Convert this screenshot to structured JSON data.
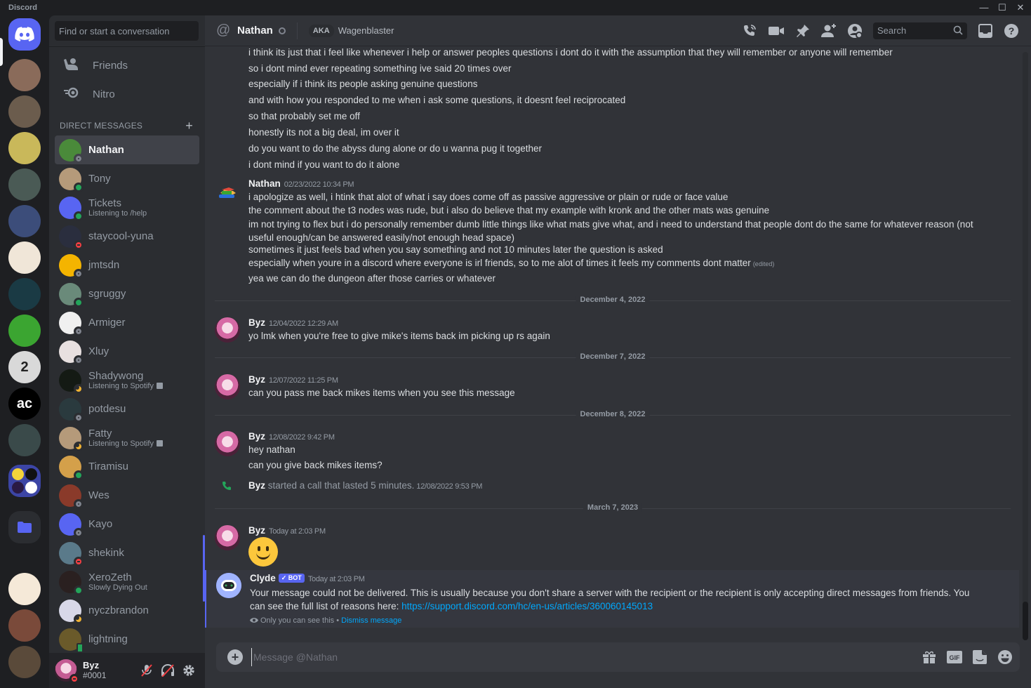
{
  "window": {
    "app_title": "Discord",
    "controls": [
      "minimize",
      "maximize",
      "close"
    ]
  },
  "server_rail": {
    "home_icon": "discord-logo-icon",
    "servers": [
      {
        "name": "server-1",
        "color": "#8a6b5a"
      },
      {
        "name": "server-2",
        "color": "#6b5c4d"
      },
      {
        "name": "server-3",
        "color": "#c9b85a"
      },
      {
        "name": "server-4",
        "color": "#4a5a55"
      },
      {
        "name": "server-5",
        "color": "#3c4d7a"
      },
      {
        "name": "server-6",
        "color": "#f0e6d8"
      },
      {
        "name": "server-7",
        "color": "#1a3a44"
      },
      {
        "name": "server-8",
        "color": "#3ba531"
      },
      {
        "name": "server-9",
        "color": "#d9d9d9",
        "label": "2"
      },
      {
        "name": "server-10",
        "color": "#000000",
        "label": "ac"
      },
      {
        "name": "server-11",
        "color": "#3a4a4a"
      },
      {
        "name": "server-12",
        "color": "#b57070"
      },
      {
        "name": "server-13",
        "color": "#f5e9d8"
      },
      {
        "name": "server-14",
        "color": "#7a4a3a"
      },
      {
        "name": "server-15",
        "color": "#5a4a3a"
      }
    ],
    "folder_icon": "folder-icon"
  },
  "sidebar": {
    "search_placeholder": "Find or start a conversation",
    "nav": [
      {
        "label": "Friends",
        "icon": "friends-icon"
      },
      {
        "label": "Nitro",
        "icon": "nitro-icon"
      }
    ],
    "dm_header": "DIRECT MESSAGES",
    "dms": [
      {
        "name": "Nathan",
        "status": "offline",
        "active": true,
        "color": "#4a8a3a"
      },
      {
        "name": "Tony",
        "status": "online",
        "color": "#b59a7a"
      },
      {
        "name": "Tickets",
        "sub": "Listening to /help",
        "status": "online",
        "color": "#5865f2"
      },
      {
        "name": "staycool-yuna",
        "status": "dnd",
        "color": "#2a2e3e"
      },
      {
        "name": "jmtsdn",
        "status": "offline",
        "color": "#f4b400"
      },
      {
        "name": "sgruggy",
        "status": "online",
        "color": "#6a8a7a"
      },
      {
        "name": "Armiger",
        "status": "offline",
        "color": "#f0f0f0"
      },
      {
        "name": "Xluy",
        "status": "offline",
        "color": "#e8e0e0"
      },
      {
        "name": "Shadywong",
        "sub": "Listening to Spotify",
        "rich": true,
        "status": "idle",
        "color": "#141a14"
      },
      {
        "name": "potdesu",
        "status": "offline",
        "color": "#2a3a3e"
      },
      {
        "name": "Fatty",
        "sub": "Listening to Spotify",
        "rich": true,
        "status": "idle",
        "color": "#b59a7a"
      },
      {
        "name": "Tiramisu",
        "status": "online",
        "color": "#d4a04a"
      },
      {
        "name": "Wes",
        "status": "offline",
        "color": "#8a3a2a"
      },
      {
        "name": "Kayo",
        "status": "offline",
        "color": "#5865f2"
      },
      {
        "name": "shekink",
        "status": "dnd",
        "color": "#5a7a8a"
      },
      {
        "name": "XeroZeth",
        "sub": "Slowly Dying Out",
        "status": "online",
        "color": "#2a2020"
      },
      {
        "name": "nyczbrandon",
        "status": "idle",
        "color": "#d8d8e8"
      },
      {
        "name": "lightning",
        "status": "mobile",
        "color": "#6a5a2a"
      }
    ],
    "user": {
      "name": "Byz",
      "tag": "#0001",
      "status": "dnd",
      "controls": [
        "mic-muted-icon",
        "headphones-deafened-icon",
        "settings-gear-icon"
      ]
    }
  },
  "header": {
    "channel_name": "Nathan",
    "aka_label": "AKA",
    "aka_value": "Wagenblaster",
    "search_placeholder": "Search",
    "icons": [
      "voice-call-icon",
      "video-call-icon",
      "pinned-messages-icon",
      "add-friends-icon",
      "user-profile-icon",
      "inbox-icon",
      "help-icon"
    ]
  },
  "messages": {
    "group1_lines": [
      "i think its just that i feel like whenever i help or answer peoples questions i dont do it with the assumption that they will remember or anyone will remember",
      "so i dont mind ever repeating something ive said 20 times over",
      "especially if i think its people asking genuine questions",
      "and with how you responded to me when i ask some questions, it doesnt feel reciprocated",
      "so that probably set me off",
      "honestly its not a big deal, im over it",
      "do you want to do the abyss dung alone or do u wanna pug it together",
      "i dont mind if you want to do it alone"
    ],
    "group2": {
      "author": "Nathan",
      "timestamp": "02/23/2022 10:34 PM",
      "lines": [
        "i apologize as well, i htink that alot of what i say does come off as passive aggressive or plain or rude or face value",
        "the comment about the t3 nodes was rude, but i also do believe that my example with kronk and the other mats was genuine",
        "im not trying to flex but i do personally remember dumb little things like what mats give what, and i need to understand that people dont do the same for whatever reason (not useful enough/can be answered easily/not enough head space)",
        "sometimes it just feels bad when you say something and not 10 minutes later the question is asked",
        "especially when youre in a discord where everyone is irl friends, so to me alot of times it feels my comments dont matter"
      ],
      "edited_label": "(edited)",
      "last_line": "yea we can do the dungeon after those carries or whatever"
    },
    "date1": "December 4, 2022",
    "group3": {
      "author": "Byz",
      "timestamp": "12/04/2022 12:29 AM",
      "lines": [
        "yo lmk when you're free to give mike's items back im picking up rs again"
      ]
    },
    "date2": "December 7, 2022",
    "group4": {
      "author": "Byz",
      "timestamp": "12/07/2022 11:25 PM",
      "lines": [
        "can you pass me back mikes items when you see this message"
      ]
    },
    "date3": "December 8, 2022",
    "group5": {
      "author": "Byz",
      "timestamp": "12/08/2022 9:42 PM",
      "lines": [
        "hey nathan",
        "can you give back mikes items?"
      ]
    },
    "call": {
      "author": "Byz",
      "text": "started a call that lasted 5 minutes.",
      "timestamp": "12/08/2022 9:53 PM",
      "icon": "phone-call-icon"
    },
    "date4": "March 7, 2023",
    "group6": {
      "author": "Byz",
      "timestamp": "Today at 2:03 PM",
      "emoji": "slightly-smiling-face"
    },
    "clyde": {
      "author": "Clyde",
      "badge": "✓ BOT",
      "timestamp": "Today at 2:03 PM",
      "text": "Your message could not be delivered. This is usually because you don't share a server with the recipient or the recipient is only accepting direct messages from friends. You can see the full list of reasons here: ",
      "link": "https://support.discord.com/hc/en-us/articles/360060145013",
      "note": "Only you can see this • ",
      "dismiss": "Dismiss message"
    }
  },
  "composer": {
    "placeholder": "Message @Nathan",
    "icons": [
      "gift-icon",
      "gif-icon",
      "sticker-icon",
      "emoji-icon"
    ],
    "gif_label": "GIF"
  },
  "colors": {
    "accent": "#5865f2",
    "online": "#23a55a",
    "dnd": "#f23f43",
    "idle": "#f0b232",
    "link": "#00a8fc"
  }
}
